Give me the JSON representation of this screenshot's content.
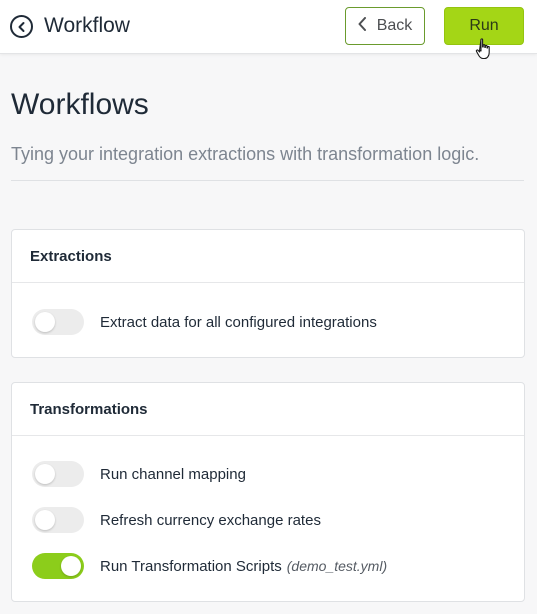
{
  "topbar": {
    "title": "Workflow",
    "back_label": "Back",
    "run_label": "Run"
  },
  "page": {
    "title": "Workflows",
    "subtitle": "Tying your integration extractions with transformation logic."
  },
  "extractions": {
    "title": "Extractions",
    "items": [
      {
        "label": "Extract data for all configured integrations",
        "enabled": false
      }
    ]
  },
  "transformations": {
    "title": "Transformations",
    "items": [
      {
        "label": "Run channel mapping",
        "enabled": false
      },
      {
        "label": "Refresh currency exchange rates",
        "enabled": false
      },
      {
        "label": "Run Transformation Scripts",
        "hint": "(demo_test.yml)",
        "enabled": true
      }
    ]
  },
  "colors": {
    "accent": "#a4d616",
    "toggle_on": "#8ccd1b",
    "toggle_off": "#ececec",
    "back_border": "#6a9b2d"
  }
}
